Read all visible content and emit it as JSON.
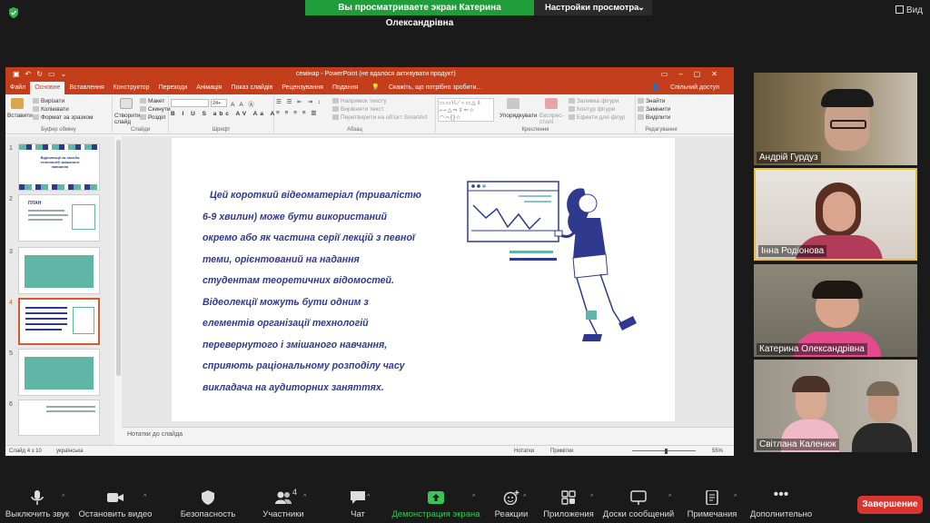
{
  "zoom_top": {
    "share_banner": "Вы просматриваете экран Катерина Олександрівна",
    "view_options": "Настройки просмотра",
    "view_button": "Вид"
  },
  "powerpoint": {
    "title": "семінар  -  PowerPoint (не вдалося активувати продукт)",
    "tabs": [
      "Файл",
      "Основне",
      "Вставлення",
      "Конструктор",
      "Переходи",
      "Анімація",
      "Показ слайдів",
      "Рецензування",
      "Подання"
    ],
    "tell_me": "Скажіть, що потрібно зробити...",
    "share": "Спільний доступ",
    "ribbon": {
      "paste": "Вставити",
      "cut": "Вирізати",
      "copy": "Копіювати",
      "format_painter": "Формат за зразком",
      "clipboard_group": "Буфер обміну",
      "new_slide": "Створити слайд",
      "layout": "Макет",
      "reset": "Скинути",
      "section": "Розділ",
      "slides_group": "Слайди",
      "font_size": "24+",
      "font_group": "Шрифт",
      "text_direction": "Напрямок тексту",
      "align_text": "Вирівняти текст",
      "smartart": "Перетворити на об'єкт SmartArt",
      "paragraph_group": "Абзац",
      "arrange": "Упорядкувати",
      "quick_styles": "Експрес-стилі",
      "shape_fill": "Заливка фігури",
      "shape_outline": "Контур фігури",
      "shape_effects": "Ефекти для фігур",
      "drawing_group": "Креслення",
      "find": "Знайти",
      "replace": "Замінити",
      "select": "Виділити",
      "editing_group": "Редагування"
    },
    "thumbnails": [
      {
        "num": "1",
        "title": "Відеолекції як засоби технологій змішаного навчання"
      },
      {
        "num": "2",
        "title": "ПЛАН"
      },
      {
        "num": "3",
        "title": ""
      },
      {
        "num": "4",
        "title": ""
      },
      {
        "num": "5",
        "title": ""
      },
      {
        "num": "6",
        "title": ""
      }
    ],
    "slide_lines": [
      "Цей короткий відеоматеріал (тривалістю",
      "6-9 хвилин) може бути використаний",
      "окремо або як частина серії лекцій з певної",
      "теми,       орієнтований       на      надання",
      "студентам      теоретичних      відомостей.",
      "Відеолекції    можуть    бути    одним    з",
      "елементів       організації       технологій",
      "перевернутого    і   змішаного    навчання,",
      "сприяють раціональному розподілу часу",
      "викладача на аудиторних заняттях."
    ],
    "notes_placeholder": "Нотатки до слайда",
    "status": {
      "slide_counter": "Слайд 4 з 10",
      "language": "українська",
      "notes": "Нотатки",
      "comments": "Примітки",
      "zoom": "55%"
    }
  },
  "participants": [
    {
      "name": "Андрій Гурдуз"
    },
    {
      "name": "Інна Родіонова"
    },
    {
      "name": "Катерина Олександрівна"
    },
    {
      "name": "Світлана Каленюк"
    }
  ],
  "toolbar": {
    "mute": "Выключить звук",
    "video": "Остановить видео",
    "security": "Безопасность",
    "participants": "Участники",
    "participants_count": "4",
    "chat": "Чат",
    "share": "Демонстрация экрана",
    "reactions": "Реакции",
    "apps": "Приложения",
    "whiteboards": "Доски сообщений",
    "notes": "Примечания",
    "more": "Дополнительно",
    "end": "Завершение"
  },
  "colors": {
    "share_green": "#1f9d3a",
    "ppt_accent": "#c43e1c",
    "slide_text": "#2f3a8f",
    "teal": "#5fb5a6",
    "end_red": "#d9352f",
    "active_speaker": "#e6c23a"
  }
}
